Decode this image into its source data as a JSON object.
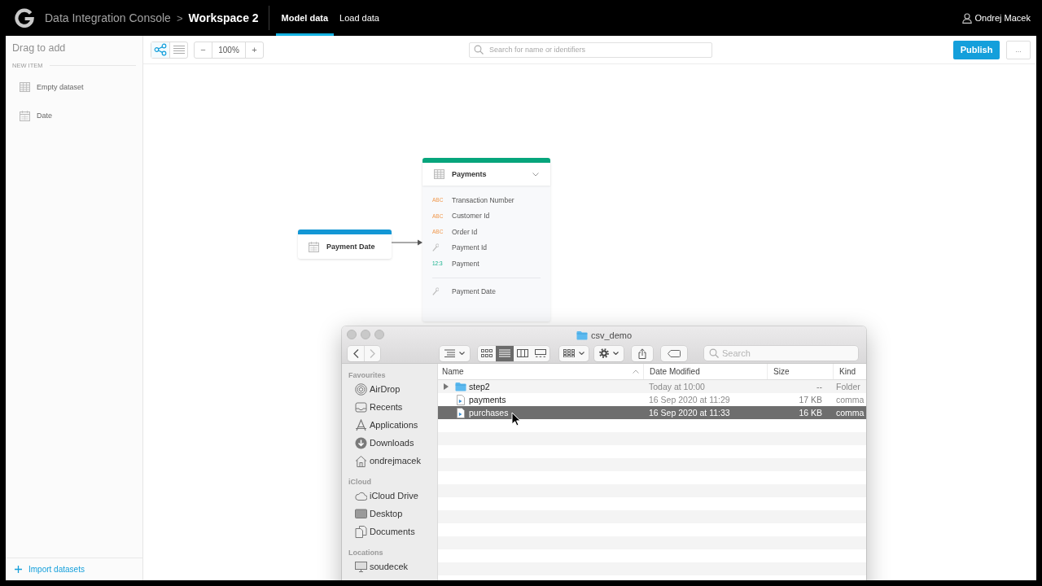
{
  "header": {
    "app_name": "Data Integration Console",
    "breadcrumb_separator": ">",
    "workspace": "Workspace 2",
    "tabs": [
      {
        "label": "Model data",
        "selected": true
      },
      {
        "label": "Load data",
        "selected": false
      }
    ],
    "user": "Ondrej Macek"
  },
  "sidebar": {
    "title": "Drag to add",
    "section": "NEW ITEM",
    "items": [
      {
        "label": "Empty dataset",
        "kind": "dataset"
      },
      {
        "label": "Date",
        "kind": "date"
      }
    ],
    "import_link": "Import datasets"
  },
  "toolbar": {
    "views": [
      {
        "kind": "graph",
        "selected": true
      },
      {
        "kind": "list",
        "selected": false
      }
    ],
    "zoom_out": "−",
    "zoom_level": "100%",
    "zoom_in": "+",
    "search": {
      "placeholder": "Search for name or identifiers"
    },
    "publish": "Publish",
    "more": "..."
  },
  "canvas": {
    "date_dataset": {
      "title": "Payment Date"
    },
    "dataset": {
      "title": "Payments",
      "fields": [
        {
          "kind": "attribute",
          "type_label": "ABC",
          "name": "Transaction Number"
        },
        {
          "kind": "attribute",
          "type_label": "ABC",
          "name": "Customer Id"
        },
        {
          "kind": "attribute",
          "type_label": "ABC",
          "name": "Order Id"
        },
        {
          "kind": "key",
          "name": "Payment Id"
        },
        {
          "kind": "fact",
          "type_label": "12:3",
          "name": "Payment"
        }
      ],
      "references": [
        {
          "kind": "key",
          "name": "Payment Date"
        }
      ]
    }
  },
  "finder": {
    "title": "csv_demo",
    "navigation": [
      {
        "kind": "back",
        "disabled": false
      },
      {
        "kind": "forward",
        "disabled": true
      }
    ],
    "view_modes": [
      {
        "kind": "icons",
        "selected": false
      },
      {
        "kind": "list",
        "selected": true
      },
      {
        "kind": "columns",
        "selected": false
      },
      {
        "kind": "gallery",
        "selected": false
      }
    ],
    "search": {
      "placeholder": "Search"
    },
    "sidebar": [
      {
        "heading": "Favourites",
        "items": [
          {
            "label": "AirDrop",
            "kind": "airdrop"
          },
          {
            "label": "Recents",
            "kind": "recents"
          },
          {
            "label": "Applications",
            "kind": "applications"
          },
          {
            "label": "Downloads",
            "kind": "downloads"
          },
          {
            "label": "ondrejmacek",
            "kind": "home"
          }
        ]
      },
      {
        "heading": "iCloud",
        "items": [
          {
            "label": "iCloud Drive",
            "kind": "icloud"
          },
          {
            "label": "Desktop",
            "kind": "desktop"
          },
          {
            "label": "Documents",
            "kind": "documents"
          }
        ]
      },
      {
        "heading": "Locations",
        "items": [
          {
            "label": "soudecek",
            "kind": "computer"
          }
        ]
      }
    ],
    "columns": [
      {
        "label": "Name",
        "sorted": true
      },
      {
        "label": "Date Modified",
        "sorted": false
      },
      {
        "label": "Size",
        "sorted": false
      },
      {
        "label": "Kind",
        "sorted": false
      }
    ],
    "rows": [
      {
        "kind": "folder",
        "name": "step2",
        "modified": "Today at 10:00",
        "size": "--",
        "file_kind": "Folder",
        "selected": false
      },
      {
        "kind": "file",
        "name": "payments",
        "modified": "16 Sep 2020 at 11:29",
        "size": "17 KB",
        "file_kind": "comma",
        "selected": false
      },
      {
        "kind": "file",
        "name": "purchases",
        "modified": "16 Sep 2020 at 11:33",
        "size": "16 KB",
        "file_kind": "comma",
        "selected": true
      }
    ]
  }
}
